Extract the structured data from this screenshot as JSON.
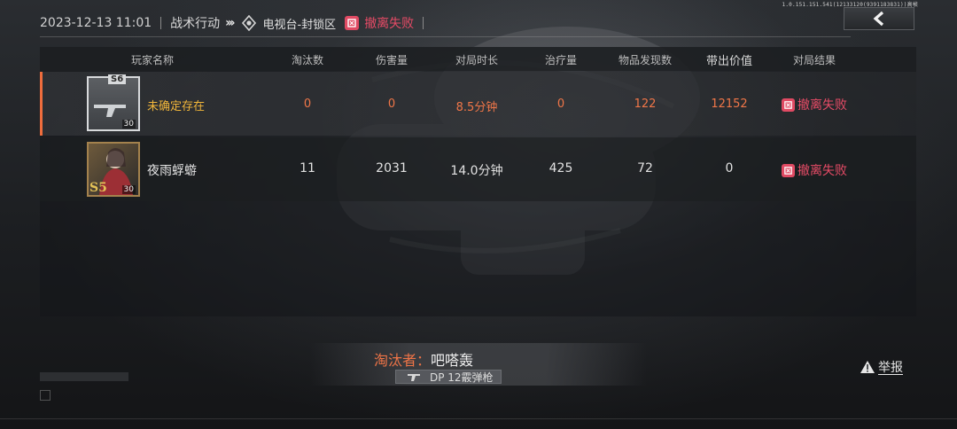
{
  "header": {
    "date": "2023-12-13 11:01",
    "mode": "战术行动",
    "map": "电视台-封锁区",
    "result_label": "撤离失败"
  },
  "version_text": "1.0.151.151.541(12133120(9391183831))高帧",
  "table": {
    "columns": [
      "玩家名称",
      "淘汰数",
      "伤害量",
      "对局时长",
      "治疗量",
      "物品发现数",
      "带出价值",
      "对局结果"
    ],
    "rows": [
      {
        "name": "未确定存在",
        "eliminations": "0",
        "damage": "0",
        "duration": "8.5分钟",
        "healing": "0",
        "items_found": "122",
        "value_extracted": "12152",
        "result": "撤离失败",
        "level": "30",
        "rank_badge": "S6",
        "highlighted": true
      },
      {
        "name": "夜雨蜉蝣",
        "eliminations": "11",
        "damage": "2031",
        "duration": "14.0分钟",
        "healing": "425",
        "items_found": "72",
        "value_extracted": "0",
        "result": "撤离失败",
        "level": "30",
        "rank_badge": "S5",
        "highlighted": false
      }
    ]
  },
  "killer": {
    "label": "淘汰者：",
    "name": "吧嗒轰",
    "weapon": "DP 12霰弹枪"
  },
  "report_label": "举报",
  "colors": {
    "accent_orange": "#ef6d3d",
    "fail_red": "#e04a63",
    "name_gold": "#f1b63a"
  },
  "icons": [
    "back-chevron-icon",
    "map-icon",
    "fail-icon",
    "weapon-icon",
    "warning-icon"
  ]
}
